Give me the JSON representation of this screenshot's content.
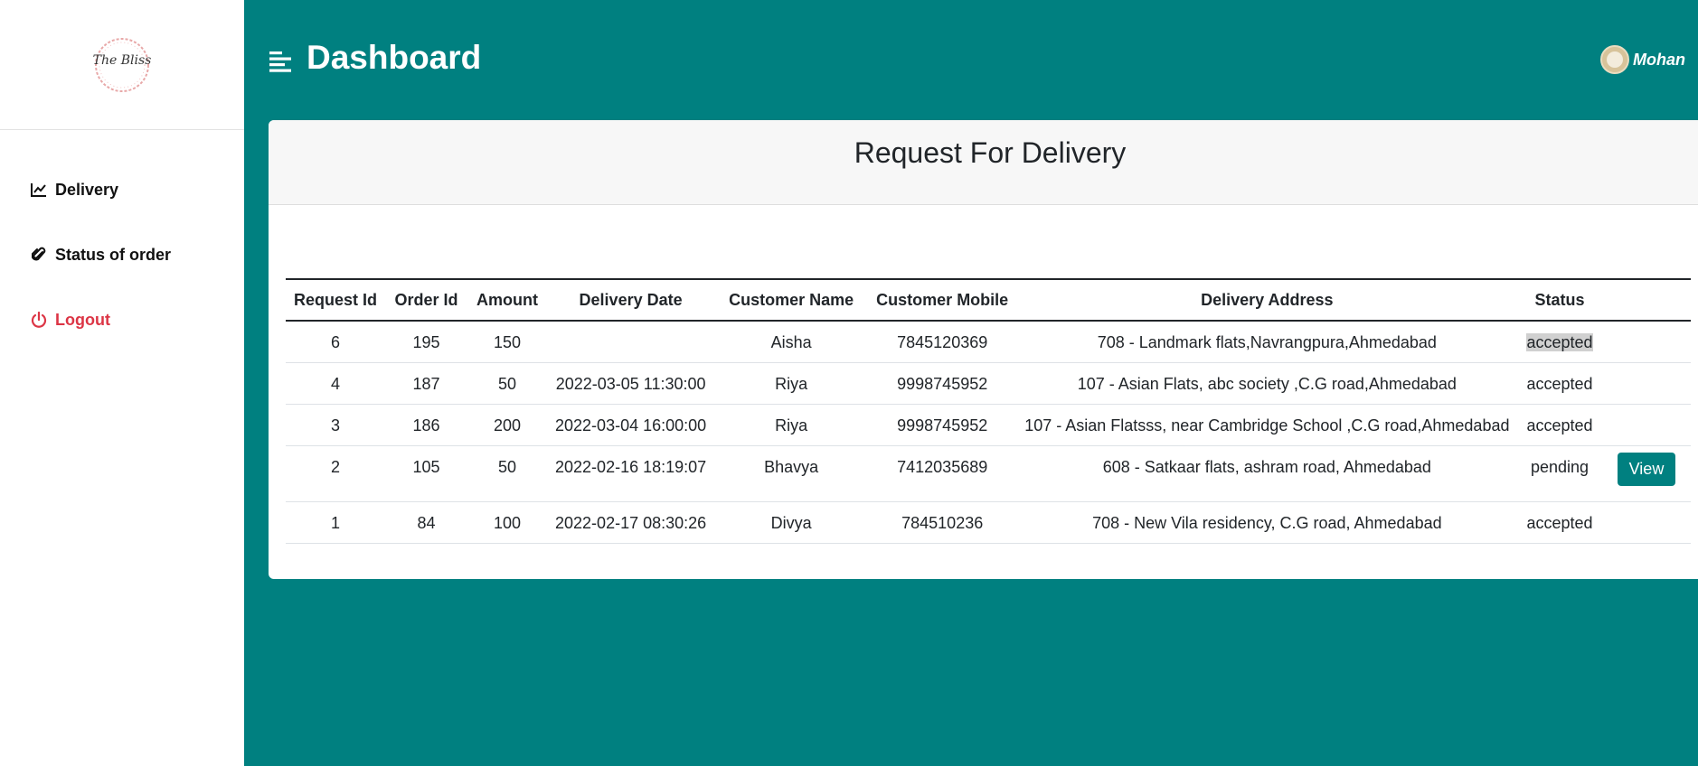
{
  "sidebar": {
    "logo_text": "The Bliss",
    "items": [
      {
        "label": "Delivery",
        "icon": "chart-line-icon"
      },
      {
        "label": "Status of order",
        "icon": "paperclip-icon"
      },
      {
        "label": "Logout",
        "icon": "power-icon"
      }
    ]
  },
  "header": {
    "title": "Dashboard",
    "user_name": "Mohan"
  },
  "card": {
    "title": "Request For Delivery"
  },
  "table": {
    "columns": [
      "Request Id",
      "Order Id",
      "Amount",
      "Delivery Date",
      "Customer Name",
      "Customer Mobile",
      "Delivery Address",
      "Status",
      ""
    ],
    "rows": [
      {
        "request_id": "6",
        "order_id": "195",
        "amount": "150",
        "date": "",
        "name": "Aisha",
        "mobile": "7845120369",
        "address": "708 - Landmark flats,Navrangpura,Ahmedabad",
        "status": "accepted",
        "action": ""
      },
      {
        "request_id": "4",
        "order_id": "187",
        "amount": "50",
        "date": "2022-03-05 11:30:00",
        "name": "Riya",
        "mobile": "9998745952",
        "address": "107 - Asian Flats, abc society ,C.G road,Ahmedabad",
        "status": "accepted",
        "action": ""
      },
      {
        "request_id": "3",
        "order_id": "186",
        "amount": "200",
        "date": "2022-03-04 16:00:00",
        "name": "Riya",
        "mobile": "9998745952",
        "address": "107 - Asian Flatsss, near Cambridge School ,C.G road,Ahmedabad",
        "status": "accepted",
        "action": ""
      },
      {
        "request_id": "2",
        "order_id": "105",
        "amount": "50",
        "date": "2022-02-16 18:19:07",
        "name": "Bhavya",
        "mobile": "7412035689",
        "address": "608 - Satkaar flats, ashram road, Ahmedabad",
        "status": "pending",
        "action": "View"
      },
      {
        "request_id": "1",
        "order_id": "84",
        "amount": "100",
        "date": "2022-02-17 08:30:26",
        "name": "Divya",
        "mobile": "784510236",
        "address": "708 - New Vila residency, C.G road, Ahmedabad",
        "status": "accepted",
        "action": ""
      }
    ]
  },
  "colors": {
    "teal": "#008080",
    "logout": "#dc3545",
    "highlight": "#d0d0d0"
  }
}
